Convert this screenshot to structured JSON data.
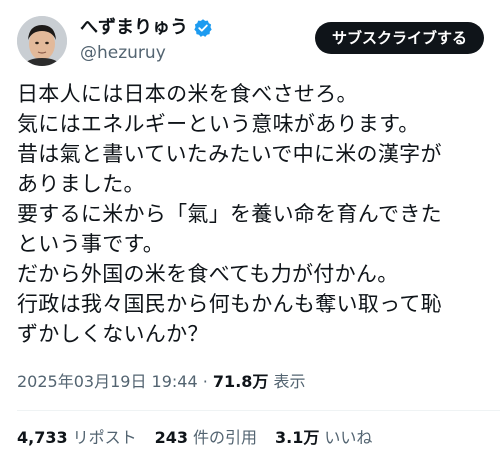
{
  "author": {
    "display_name": "へずまりゅう",
    "handle": "@hezuruy",
    "verified_color": "#1d9bf0"
  },
  "subscribe_label": "サブスクライブする",
  "tweet": {
    "lines": [
      "日本人には日本の米を食べさせろ。",
      "気にはエネルギーという意味があります。",
      "昔は氣と書いていたみたいで中に米の漢字が",
      "ありました。",
      "要するに米から「氣」を養い命を育んできた",
      "という事です。",
      "だから外国の米を食べても力が付かん。",
      "行政は我々国民から何もかんも奪い取って恥",
      "ずかしくないんか？"
    ]
  },
  "meta": {
    "timestamp": "2025年03月19日 19:44",
    "separator": "·",
    "views_count": "71.8万",
    "views_label": "表示"
  },
  "stats": {
    "reposts": {
      "count": "4,733",
      "label": "リポスト"
    },
    "quotes": {
      "count": "243",
      "label": "件の引用"
    },
    "likes": {
      "count": "3.1万",
      "label": "いいね"
    }
  },
  "colors": {
    "text": "#0f1419",
    "secondary": "#536471",
    "button_bg": "#0f1419",
    "divider": "#eff3f4"
  }
}
